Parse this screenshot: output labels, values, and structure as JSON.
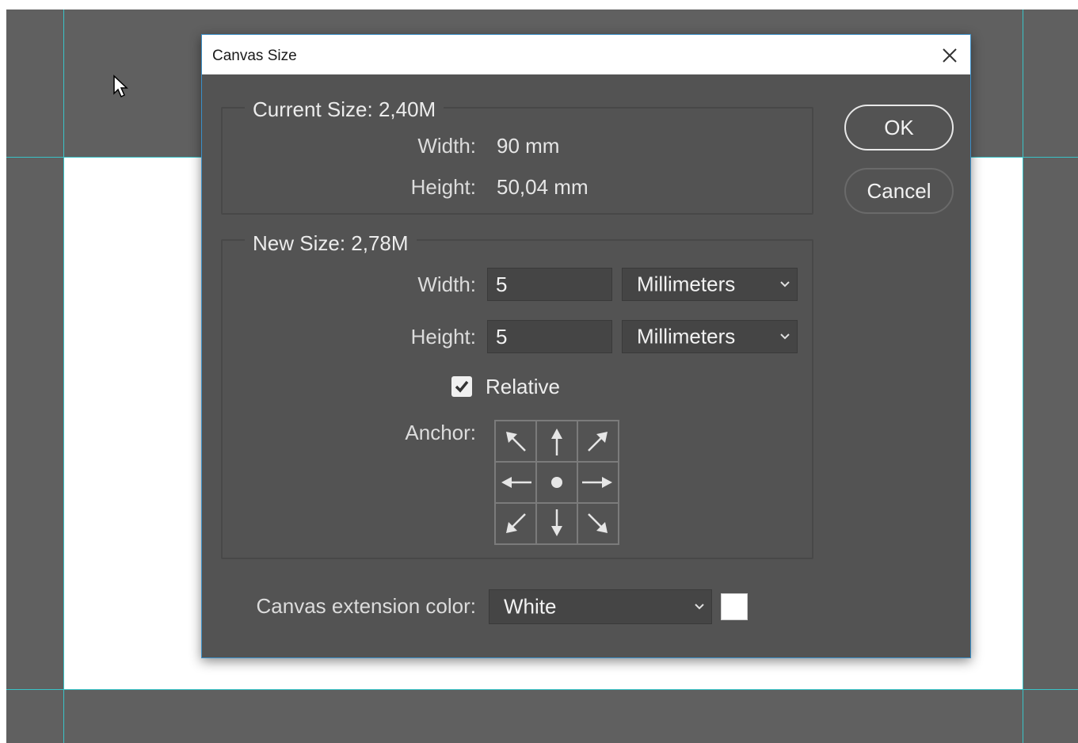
{
  "dialog": {
    "title": "Canvas Size",
    "current_size": {
      "legend": "Current Size: 2,40M",
      "width_label": "Width:",
      "width_value": "90 mm",
      "height_label": "Height:",
      "height_value": "50,04 mm"
    },
    "new_size": {
      "legend": "New Size: 2,78M",
      "width_label": "Width:",
      "width_value": "5",
      "width_unit": "Millimeters",
      "height_label": "Height:",
      "height_value": "5",
      "height_unit": "Millimeters",
      "relative_label": "Relative",
      "relative_checked": true,
      "anchor_label": "Anchor:",
      "anchor_selected": "center"
    },
    "extension": {
      "label": "Canvas extension color:",
      "value": "White",
      "swatch_color": "#ffffff"
    },
    "buttons": {
      "ok": "OK",
      "cancel": "Cancel"
    }
  },
  "colors": {
    "dialog_bg": "#535353",
    "workspace_bg": "#606060",
    "guide": "#39c3c7",
    "accent_border": "#3b8fc8"
  },
  "icons": [
    "cursor-arrow-icon",
    "close-icon",
    "chevron-down-icon",
    "checkmark-icon",
    "anchor-arrow-icon",
    "anchor-center-dot-icon"
  ]
}
